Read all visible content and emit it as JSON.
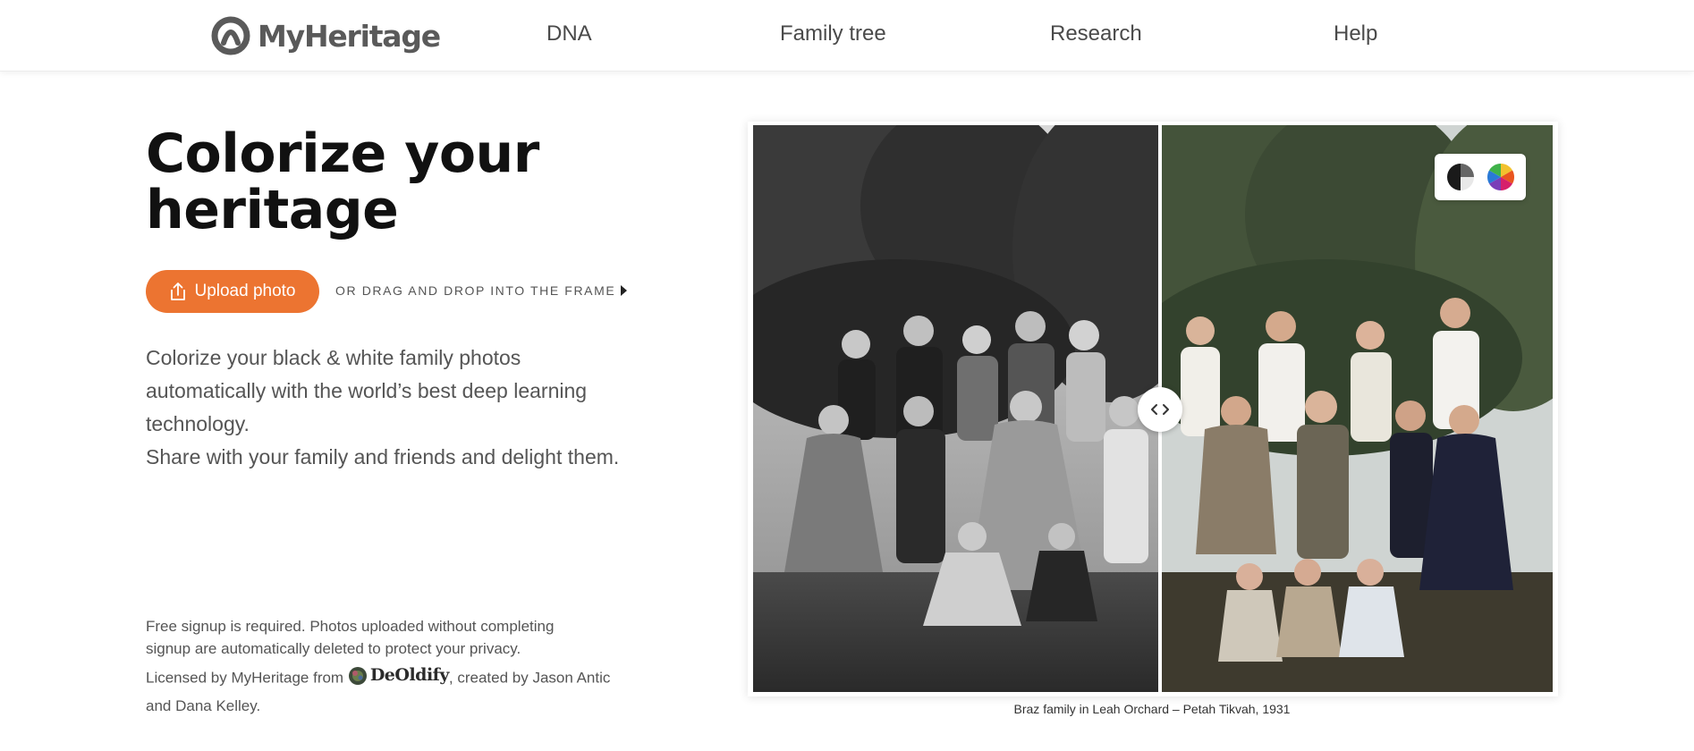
{
  "header": {
    "logo_text": "MyHeritage",
    "nav": [
      "DNA",
      "Family tree",
      "Research",
      "Help"
    ]
  },
  "hero": {
    "title_line1": "Colorize your",
    "title_line2": "heritage",
    "upload_label": "Upload photo",
    "drag_hint": "OR DRAG AND DROP INTO THE FRAME",
    "desc_line1": "Colorize your black & white family photos",
    "desc_line2": "automatically with the world’s best deep learning",
    "desc_line3": "technology.",
    "desc_line4": "Share with your family and friends and delight them."
  },
  "legal": {
    "signup_line1": "Free signup is required. Photos uploaded without completing",
    "signup_line2": "signup are automatically deleted to protect your privacy.",
    "licensed_prefix": "Licensed by MyHeritage from ",
    "deoldify_text": "DeOldify",
    "licensed_suffix": ", created by Jason Antic",
    "licensed_line2": "and Dana Kelley."
  },
  "photo": {
    "caption": "Braz family in Leah Orchard – Petah Tikvah, 1931",
    "modes": [
      "black-and-white-icon",
      "color-wheel-icon"
    ]
  },
  "colors": {
    "accent": "#ec7431",
    "text_dark": "#111111",
    "text_muted": "#555555"
  }
}
